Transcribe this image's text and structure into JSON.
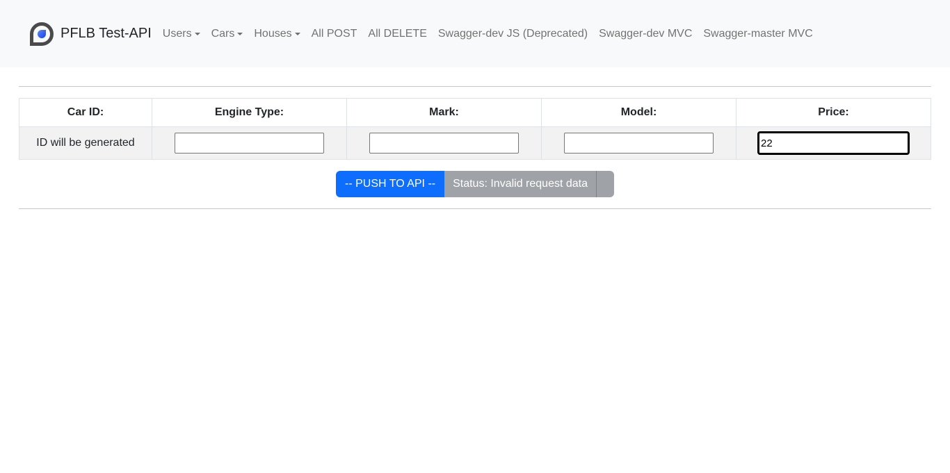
{
  "nav": {
    "brand": "PFLB Test-API",
    "items": [
      {
        "label": "Users",
        "dropdown": true
      },
      {
        "label": "Cars",
        "dropdown": true
      },
      {
        "label": "Houses",
        "dropdown": true
      },
      {
        "label": "All POST"
      },
      {
        "label": "All DELETE"
      },
      {
        "label": "Swagger-dev JS (Deprecated)"
      },
      {
        "label": "Swagger-dev MVC"
      },
      {
        "label": "Swagger-master MVC"
      }
    ]
  },
  "table": {
    "headers": [
      "Car ID:",
      "Engine Type:",
      "Mark:",
      "Model:",
      "Price:"
    ],
    "id_text": "ID will be generated",
    "engine": "",
    "mark": "",
    "model": "",
    "price": "22"
  },
  "actions": {
    "push": "-- PUSH TO API --",
    "status": "Status: Invalid request data"
  }
}
